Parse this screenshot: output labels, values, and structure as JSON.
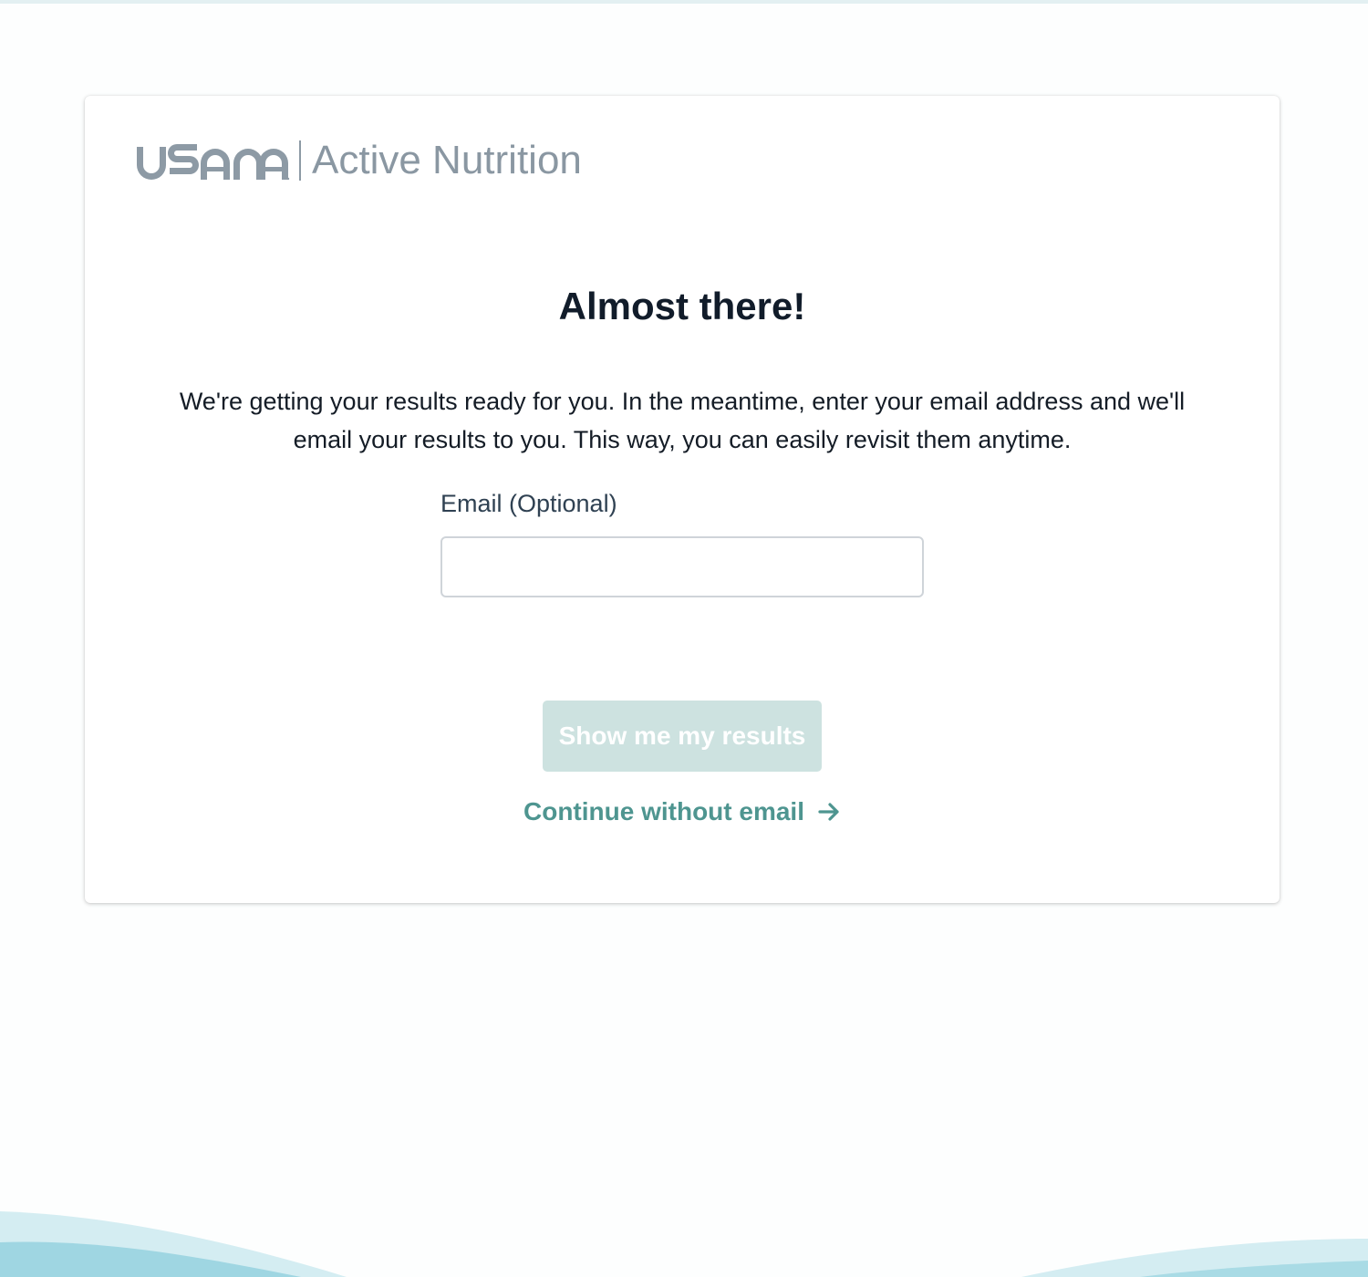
{
  "brand": {
    "logo_text": "USANA",
    "subtitle": "Active Nutrition"
  },
  "main": {
    "title": "Almost there!",
    "intro": "We're getting your results ready for you. In the meantime, enter your email address and we'll email your results to you. This way, you can easily revisit them anytime."
  },
  "form": {
    "email_label": "Email (Optional)",
    "email_value": "",
    "email_placeholder": ""
  },
  "actions": {
    "submit_label": "Show me my results",
    "continue_label": "Continue without email"
  },
  "colors": {
    "accent": "#4e9590",
    "button_disabled": "#cde2e0",
    "heading": "#111c2a",
    "brand_gray": "#8a97a2",
    "wave_light": "#cfeaf0",
    "wave_dark": "#9dd6e2"
  },
  "icons": {
    "continue": "arrow-right-icon"
  }
}
